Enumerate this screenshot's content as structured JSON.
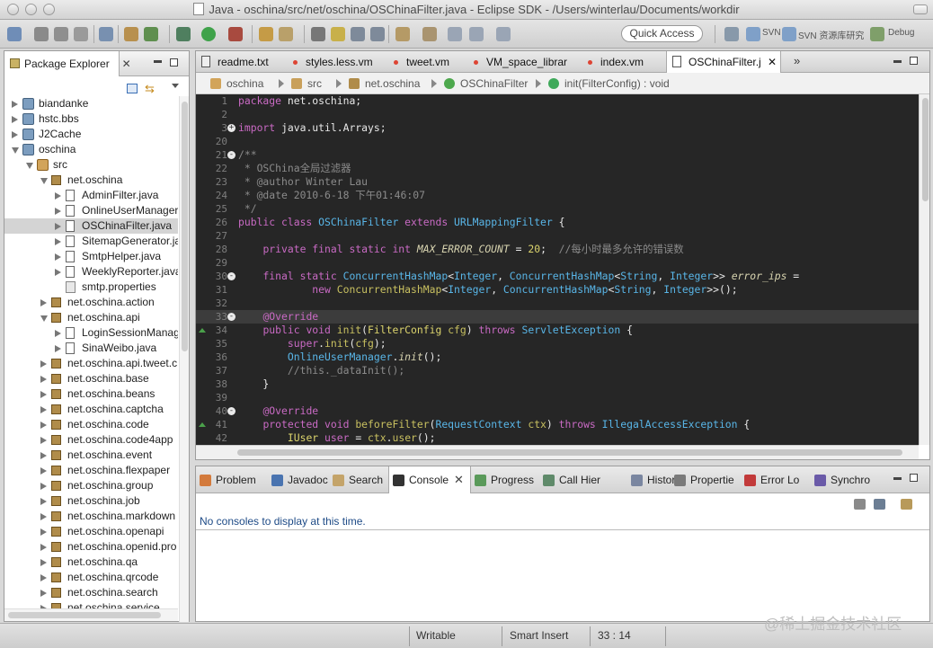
{
  "window": {
    "title": "Java - oschina/src/net/oschina/OSChinaFilter.java - Eclipse SDK - /Users/winterlau/Documents/workdir"
  },
  "toolbar": {
    "quick_access": "Quick Access",
    "perspectives": [
      "SVN",
      "SVN 资源库研究",
      "Debug"
    ]
  },
  "package_explorer": {
    "tab_label": "Package Explorer",
    "nodes": [
      {
        "label": "biandanke",
        "depth": 0,
        "icon": "project-icon",
        "state": "collapsed"
      },
      {
        "label": "hstc.bbs",
        "depth": 0,
        "icon": "project-icon",
        "state": "collapsed"
      },
      {
        "label": "J2Cache",
        "depth": 0,
        "icon": "project-icon",
        "state": "collapsed"
      },
      {
        "label": "oschina",
        "depth": 0,
        "icon": "project-icon",
        "state": "expanded"
      },
      {
        "label": "src",
        "depth": 1,
        "icon": "source-folder-icon",
        "state": "expanded"
      },
      {
        "label": "net.oschina",
        "depth": 2,
        "icon": "package-icon",
        "state": "expanded"
      },
      {
        "label": "AdminFilter.java",
        "depth": 3,
        "icon": "java-file-icon",
        "state": "collapsed"
      },
      {
        "label": "OnlineUserManager",
        "depth": 3,
        "icon": "java-file-icon",
        "state": "collapsed"
      },
      {
        "label": "OSChinaFilter.java",
        "depth": 3,
        "icon": "java-file-icon",
        "state": "collapsed",
        "selected": true
      },
      {
        "label": "SitemapGenerator.ja",
        "depth": 3,
        "icon": "java-file-icon",
        "state": "collapsed"
      },
      {
        "label": "SmtpHelper.java",
        "depth": 3,
        "icon": "java-file-icon",
        "state": "collapsed"
      },
      {
        "label": "WeeklyReporter.java",
        "depth": 3,
        "icon": "java-file-icon",
        "state": "collapsed"
      },
      {
        "label": "smtp.properties",
        "depth": 3,
        "icon": "properties-file-icon",
        "state": "none"
      },
      {
        "label": "net.oschina.action",
        "depth": 2,
        "icon": "package-icon",
        "state": "collapsed"
      },
      {
        "label": "net.oschina.api",
        "depth": 2,
        "icon": "package-icon",
        "state": "expanded"
      },
      {
        "label": "LoginSessionManag",
        "depth": 3,
        "icon": "java-file-icon",
        "state": "collapsed"
      },
      {
        "label": "SinaWeibo.java",
        "depth": 3,
        "icon": "java-file-icon",
        "state": "collapsed"
      },
      {
        "label": "net.oschina.api.tweet.c",
        "depth": 2,
        "icon": "package-icon",
        "state": "collapsed"
      },
      {
        "label": "net.oschina.base",
        "depth": 2,
        "icon": "package-icon",
        "state": "collapsed"
      },
      {
        "label": "net.oschina.beans",
        "depth": 2,
        "icon": "package-icon",
        "state": "collapsed"
      },
      {
        "label": "net.oschina.captcha",
        "depth": 2,
        "icon": "package-icon",
        "state": "collapsed"
      },
      {
        "label": "net.oschina.code",
        "depth": 2,
        "icon": "package-icon",
        "state": "collapsed"
      },
      {
        "label": "net.oschina.code4app",
        "depth": 2,
        "icon": "package-icon",
        "state": "collapsed"
      },
      {
        "label": "net.oschina.event",
        "depth": 2,
        "icon": "package-icon",
        "state": "collapsed"
      },
      {
        "label": "net.oschina.flexpaper",
        "depth": 2,
        "icon": "package-icon",
        "state": "collapsed"
      },
      {
        "label": "net.oschina.group",
        "depth": 2,
        "icon": "package-icon",
        "state": "collapsed"
      },
      {
        "label": "net.oschina.job",
        "depth": 2,
        "icon": "package-icon",
        "state": "collapsed"
      },
      {
        "label": "net.oschina.markdown",
        "depth": 2,
        "icon": "package-icon",
        "state": "collapsed"
      },
      {
        "label": "net.oschina.openapi",
        "depth": 2,
        "icon": "package-icon",
        "state": "collapsed"
      },
      {
        "label": "net.oschina.openid.pro",
        "depth": 2,
        "icon": "package-icon",
        "state": "collapsed"
      },
      {
        "label": "net.oschina.qa",
        "depth": 2,
        "icon": "package-icon",
        "state": "collapsed"
      },
      {
        "label": "net.oschina.qrcode",
        "depth": 2,
        "icon": "package-icon",
        "state": "collapsed"
      },
      {
        "label": "net.oschina.search",
        "depth": 2,
        "icon": "package-icon",
        "state": "collapsed"
      },
      {
        "label": "net.oschina.service",
        "depth": 2,
        "icon": "package-icon",
        "state": "collapsed"
      }
    ]
  },
  "editor": {
    "tabs": [
      {
        "label": "readme.txt",
        "dirty": false
      },
      {
        "label": "styles.less.vm",
        "dirty": true
      },
      {
        "label": "tweet.vm",
        "dirty": true
      },
      {
        "label": "VM_space_librar",
        "dirty": true
      },
      {
        "label": "index.vm",
        "dirty": true
      },
      {
        "label": "OSChinaFilter.j",
        "dirty": false,
        "active": true
      }
    ],
    "overflow_label": "»",
    "breadcrumb": [
      "oschina",
      "src",
      "net.oschina",
      "OSChinaFilter",
      "init(FilterConfig) : void"
    ],
    "lines": [
      {
        "num": "1",
        "fold": "",
        "segs": [
          [
            "k",
            "package "
          ],
          [
            "",
            "net.oschina;"
          ]
        ]
      },
      {
        "num": "2",
        "fold": "",
        "segs": []
      },
      {
        "num": "3",
        "fold": "+",
        "segs": [
          [
            "k",
            "import "
          ],
          [
            "",
            "java.util.Arrays;"
          ]
        ]
      },
      {
        "num": "20",
        "fold": "",
        "segs": []
      },
      {
        "num": "21",
        "fold": "-",
        "segs": [
          [
            "c",
            "/**"
          ]
        ]
      },
      {
        "num": "22",
        "fold": "",
        "segs": [
          [
            "c",
            " * OSChina全局过滤器"
          ]
        ]
      },
      {
        "num": "23",
        "fold": "",
        "segs": [
          [
            "c",
            " * @author Winter Lau"
          ]
        ]
      },
      {
        "num": "24",
        "fold": "",
        "segs": [
          [
            "c",
            " * @date 2010-6-18 下午01:46:07"
          ]
        ]
      },
      {
        "num": "25",
        "fold": "",
        "segs": [
          [
            "c",
            " */"
          ]
        ]
      },
      {
        "num": "26",
        "fold": "",
        "segs": [
          [
            "k",
            "public class "
          ],
          [
            "t",
            "OSChinaFilter "
          ],
          [
            "k",
            "extends "
          ],
          [
            "t",
            "URLMappingFilter "
          ],
          [
            "",
            "{"
          ]
        ]
      },
      {
        "num": "27",
        "fold": "",
        "segs": []
      },
      {
        "num": "28",
        "fold": "",
        "segs": [
          [
            "",
            "    "
          ],
          [
            "k",
            "private final static int "
          ],
          [
            "i",
            "MAX_ERROR_COUNT"
          ],
          [
            "",
            " = "
          ],
          [
            "n",
            "20"
          ],
          [
            "",
            ";  "
          ],
          [
            "c",
            "//每小时最多允许的错误数"
          ]
        ]
      },
      {
        "num": "29",
        "fold": "",
        "segs": []
      },
      {
        "num": "30",
        "fold": "-",
        "segs": [
          [
            "",
            "    "
          ],
          [
            "k",
            "final static "
          ],
          [
            "t",
            "ConcurrentHashMap"
          ],
          [
            "",
            "<"
          ],
          [
            "t",
            "Integer"
          ],
          [
            ", "
          ],
          [
            "t",
            "ConcurrentHashMap"
          ],
          [
            "",
            "<"
          ],
          [
            "t",
            "String"
          ],
          [
            "",
            ", "
          ],
          [
            "t",
            "Integer"
          ],
          [
            "",
            ">> "
          ],
          [
            "i",
            "error_ips"
          ],
          [
            "",
            " ="
          ]
        ]
      },
      {
        "num": "31",
        "fold": "",
        "segs": [
          [
            "",
            "            "
          ],
          [
            "k",
            "new "
          ],
          [
            "f",
            "ConcurrentHashMap"
          ],
          [
            "",
            "<"
          ],
          [
            "t",
            "Integer"
          ],
          [
            "",
            ", "
          ],
          [
            "t",
            "ConcurrentHashMap"
          ],
          [
            "",
            "<"
          ],
          [
            "t",
            "String"
          ],
          [
            "",
            ", "
          ],
          [
            "t",
            "Integer"
          ],
          [
            "",
            ">>();"
          ]
        ]
      },
      {
        "num": "32",
        "fold": "",
        "segs": []
      },
      {
        "num": "33",
        "fold": "-",
        "segs": [
          [
            "",
            "    "
          ],
          [
            "a",
            "@Override"
          ]
        ],
        "highlight": true
      },
      {
        "num": "34",
        "fold": "",
        "segs": [
          [
            "",
            "    "
          ],
          [
            "k",
            "public void "
          ],
          [
            "f",
            "init"
          ],
          [
            "",
            "("
          ],
          [
            "n",
            "FilterConfig "
          ],
          [
            "f",
            "cfg"
          ],
          [
            ") "
          ],
          [
            "k",
            "throws "
          ],
          [
            "t",
            "ServletException "
          ],
          [
            "",
            "{"
          ]
        ],
        "marker": true
      },
      {
        "num": "35",
        "fold": "",
        "segs": [
          [
            "",
            "        "
          ],
          [
            "k",
            "super"
          ],
          [
            "",
            "."
          ],
          [
            "f",
            "init"
          ],
          [
            "",
            "("
          ],
          [
            "f",
            "cfg"
          ],
          [
            "",
            ");"
          ]
        ]
      },
      {
        "num": "36",
        "fold": "",
        "segs": [
          [
            "",
            "        "
          ],
          [
            "t",
            "OnlineUserManager"
          ],
          [
            "",
            "."
          ],
          [
            "i",
            "init"
          ],
          [
            "",
            "();"
          ]
        ]
      },
      {
        "num": "37",
        "fold": "",
        "segs": [
          [
            "",
            "        "
          ],
          [
            "c",
            "//this._dataInit();"
          ]
        ]
      },
      {
        "num": "38",
        "fold": "",
        "segs": [
          [
            "",
            "    }"
          ]
        ]
      },
      {
        "num": "39",
        "fold": "",
        "segs": []
      },
      {
        "num": "40",
        "fold": "-",
        "segs": [
          [
            "",
            "    "
          ],
          [
            "a",
            "@Override"
          ]
        ]
      },
      {
        "num": "41",
        "fold": "",
        "segs": [
          [
            "",
            "    "
          ],
          [
            "k",
            "protected void "
          ],
          [
            "f",
            "beforeFilter"
          ],
          [
            "",
            "("
          ],
          [
            "t",
            "RequestContext "
          ],
          [
            "f",
            "ctx"
          ],
          [
            ") "
          ],
          [
            "k",
            "throws "
          ],
          [
            "t",
            "IllegalAccessException "
          ],
          [
            "",
            "{"
          ]
        ],
        "marker": true
      },
      {
        "num": "42",
        "fold": "",
        "segs": [
          [
            "",
            "        "
          ],
          [
            "n",
            "IUser "
          ],
          [
            "k",
            "user"
          ],
          [
            "",
            " = "
          ],
          [
            "f",
            "ctx"
          ],
          [
            "",
            "."
          ],
          [
            "f",
            "user"
          ],
          [
            "",
            "();"
          ]
        ]
      }
    ]
  },
  "bottom_panel": {
    "tabs": [
      {
        "label": "Problem",
        "icon": "problems-icon"
      },
      {
        "label": "Javadoc",
        "icon": "javadoc-icon"
      },
      {
        "label": "Search",
        "icon": "search-icon"
      },
      {
        "label": "Console",
        "icon": "console-icon",
        "active": true
      },
      {
        "label": "Progress",
        "icon": "progress-icon"
      },
      {
        "label": "Call Hier",
        "icon": "call-hierarchy-icon"
      },
      {
        "label": "History",
        "icon": "history-icon"
      },
      {
        "label": "Propertie",
        "icon": "properties-icon"
      },
      {
        "label": "Error Lo",
        "icon": "error-log-icon"
      },
      {
        "label": "Synchro",
        "icon": "synchronize-icon"
      }
    ],
    "console_message": "No consoles to display at this time."
  },
  "status_bar": {
    "writable": "Writable",
    "insert_mode": "Smart Insert",
    "position": "33 : 14"
  },
  "watermark": "@稀土掘金技术社区",
  "colors": {
    "editor_bg": "#262626",
    "keyword": "#c96ac4",
    "type": "#59b6e8",
    "comment": "#8b8b8b"
  }
}
